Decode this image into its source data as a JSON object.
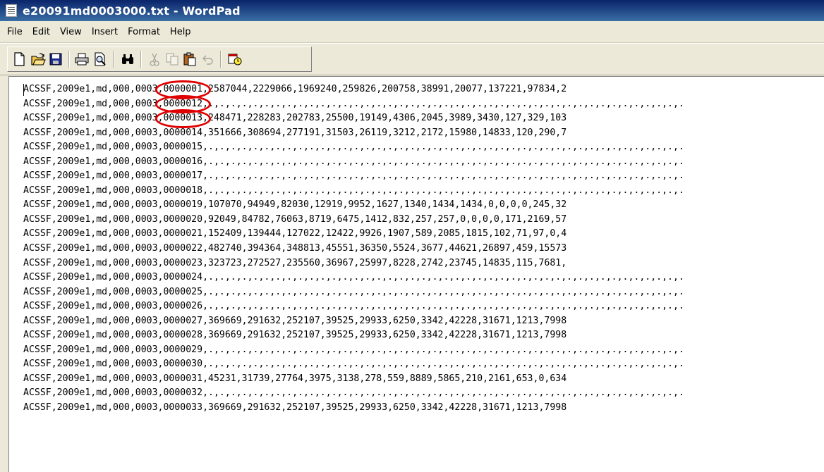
{
  "window": {
    "title": "e20091md0003000.txt - WordPad",
    "icon": "document-icon"
  },
  "menu": [
    {
      "label": "File"
    },
    {
      "label": "Edit"
    },
    {
      "label": "View"
    },
    {
      "label": "Insert"
    },
    {
      "label": "Format"
    },
    {
      "label": "Help"
    }
  ],
  "toolbar": {
    "buttons": [
      {
        "name": "new-icon",
        "enabled": true
      },
      {
        "name": "open-icon",
        "enabled": true
      },
      {
        "name": "save-icon",
        "enabled": true
      },
      {
        "name": "print-icon",
        "enabled": true
      },
      {
        "name": "print-preview-icon",
        "enabled": true
      },
      {
        "name": "find-icon",
        "enabled": true
      },
      {
        "name": "cut-icon",
        "enabled": false
      },
      {
        "name": "copy-icon",
        "enabled": false
      },
      {
        "name": "paste-icon",
        "enabled": true
      },
      {
        "name": "undo-icon",
        "enabled": false
      },
      {
        "name": "date-time-icon",
        "enabled": true
      }
    ]
  },
  "document": {
    "lines": [
      "ACSSF,2009e1,md,000,0003,0000001,2587044,2229066,1969240,259826,200758,38991,20077,137221,97834,2",
      "ACSSF,2009e1,md,000,0003,0000012,.,.,.,.,.,.,.,.,.,.,.,.,.,.,.,.,.,.,.,.,.,.,.,.,.,.,.,.,.,.,.,.,.,.,.,.,.,.,.,.,.,.,.",
      "ACSSF,2009e1,md,000,0003,0000013,248471,228283,202783,25500,19149,4306,2045,3989,3430,127,329,103",
      "ACSSF,2009e1,md,000,0003,0000014,351666,308694,277191,31503,26119,3212,2172,15980,14833,120,290,7",
      "ACSSF,2009e1,md,000,0003,0000015,.,.,.,.,.,.,.,.,.,.,.,.,.,.,.,.,.,.,.,.,.,.,.,.,.,.,.,.,.,.,.,.,.,.,.,.,.,.,.,.,.,.,.",
      "ACSSF,2009e1,md,000,0003,0000016,.,.,.,.,.,.,.,.,.,.,.,.,.,.,.,.,.,.,.,.,.,.,.,.,.,.,.,.,.,.,.,.,.,.,.,.,.,.,.,.,.,.,.",
      "ACSSF,2009e1,md,000,0003,0000017,.,.,.,.,.,.,.,.,.,.,.,.,.,.,.,.,.,.,.,.,.,.,.,.,.,.,.,.,.,.,.,.,.,.,.,.,.,.,.,.,.,.,.",
      "ACSSF,2009e1,md,000,0003,0000018,.,.,.,.,.,.,.,.,.,.,.,.,.,.,.,.,.,.,.,.,.,.,.,.,.,.,.,.,.,.,.,.,.,.,.,.,.,.,.,.,.,.,.",
      "ACSSF,2009e1,md,000,0003,0000019,107070,94949,82030,12919,9952,1627,1340,1434,1434,0,0,0,0,245,32",
      "ACSSF,2009e1,md,000,0003,0000020,92049,84782,76063,8719,6475,1412,832,257,257,0,0,0,0,171,2169,57",
      "ACSSF,2009e1,md,000,0003,0000021,152409,139444,127022,12422,9926,1907,589,2085,1815,102,71,97,0,4",
      "ACSSF,2009e1,md,000,0003,0000022,482740,394364,348813,45551,36350,5524,3677,44621,26897,459,15573",
      "ACSSF,2009e1,md,000,0003,0000023,323723,272527,235560,36967,25997,8228,2742,23745,14835,115,7681,",
      "ACSSF,2009e1,md,000,0003,0000024,.,.,.,.,.,.,.,.,.,.,.,.,.,.,.,.,.,.,.,.,.,.,.,.,.,.,.,.,.,.,.,.,.,.,.,.,.,.,.,.,.,.,.",
      "ACSSF,2009e1,md,000,0003,0000025,.,.,.,.,.,.,.,.,.,.,.,.,.,.,.,.,.,.,.,.,.,.,.,.,.,.,.,.,.,.,.,.,.,.,.,.,.,.,.,.,.,.,.",
      "ACSSF,2009e1,md,000,0003,0000026,.,.,.,.,.,.,.,.,.,.,.,.,.,.,.,.,.,.,.,.,.,.,.,.,.,.,.,.,.,.,.,.,.,.,.,.,.,.,.,.,.,.,.",
      "ACSSF,2009e1,md,000,0003,0000027,369669,291632,252107,39525,29933,6250,3342,42228,31671,1213,7998",
      "ACSSF,2009e1,md,000,0003,0000028,369669,291632,252107,39525,29933,6250,3342,42228,31671,1213,7998",
      "ACSSF,2009e1,md,000,0003,0000029,.,.,.,.,.,.,.,.,.,.,.,.,.,.,.,.,.,.,.,.,.,.,.,.,.,.,.,.,.,.,.,.,.,.,.,.,.,.,.,.,.,.,.",
      "ACSSF,2009e1,md,000,0003,0000030,.,.,.,.,.,.,.,.,.,.,.,.,.,.,.,.,.,.,.,.,.,.,.,.,.,.,.,.,.,.,.,.,.,.,.,.,.,.,.,.,.,.,.",
      "ACSSF,2009e1,md,000,0003,0000031,45231,31739,27764,3975,3138,278,559,8889,5865,210,2161,653,0,634",
      "ACSSF,2009e1,md,000,0003,0000032,.,.,.,.,.,.,.,.,.,.,.,.,.,.,.,.,.,.,.,.,.,.,.,.,.,.,.,.,.,.,.,.,.,.,.,.,.,.,.,.,.,.,.",
      "ACSSF,2009e1,md,000,0003,0000033,369669,291632,252107,39525,29933,6250,3342,42228,31671,1213,7998"
    ],
    "highlighted_rows": [
      0,
      1,
      2
    ],
    "highlight_color": "#e00000"
  },
  "colors": {
    "title_bar": "#0a246a",
    "chrome": "#ece9d8",
    "document_bg": "#ffffff"
  }
}
